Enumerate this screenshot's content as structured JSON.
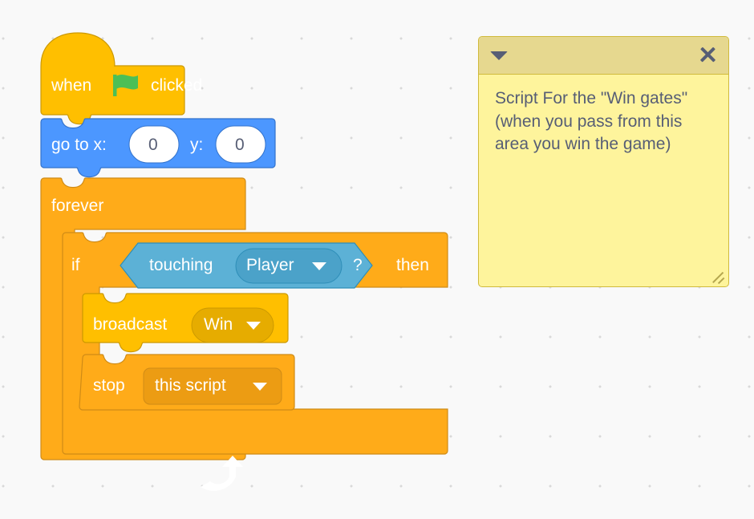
{
  "canvas": {
    "background_color": "#f9f9f9",
    "grid_dot_color": "#d9d9d9"
  },
  "palette": {
    "events": "#ffbf00",
    "events_stroke": "#cc9900",
    "motion": "#4c97ff",
    "motion_stroke": "#3373cc",
    "control": "#ffab19",
    "control_stroke": "#cf8b17",
    "control_dropdown": "#ec9c13",
    "sensing": "#5cb1d6",
    "sensing_stroke": "#2e8eb8",
    "sensing_dropdown": "#4ba2c9",
    "broadcast_dropdown": "#e6ac00",
    "text_white": "#ffffff",
    "input_white": "#ffffff",
    "input_text": "#575e75",
    "flag_green": "#4cbf56",
    "comment_body": "#fef49c",
    "comment_header": "#e6d88f",
    "comment_border": "#d0ba3c",
    "comment_text": "#575e75"
  },
  "script": {
    "hat_block": {
      "label_before": "when",
      "icon": "green-flag-icon",
      "label_after": "clicked"
    },
    "goto_block": {
      "label_x": "go to x:",
      "value_x": "0",
      "label_y": "y:",
      "value_y": "0"
    },
    "forever_block": {
      "label": "forever",
      "loop_icon": "loop-arrow-icon"
    },
    "if_block": {
      "label_if": "if",
      "label_then": "then"
    },
    "touching_block": {
      "label": "touching",
      "dropdown_value": "Player",
      "label_suffix": "?",
      "dropdown_icon": "chevron-down-icon"
    },
    "broadcast_block": {
      "label": "broadcast",
      "dropdown_value": "Win",
      "dropdown_icon": "chevron-down-icon"
    },
    "stop_block": {
      "label": "stop",
      "dropdown_value": "this script",
      "dropdown_icon": "chevron-down-icon"
    }
  },
  "comment": {
    "text": "Script For the \"Win gates\"(when you pass from this area you win the game)",
    "collapse_icon": "triangle-down-icon",
    "close_icon": "close-icon",
    "resize_icon": "resize-handle-icon"
  }
}
